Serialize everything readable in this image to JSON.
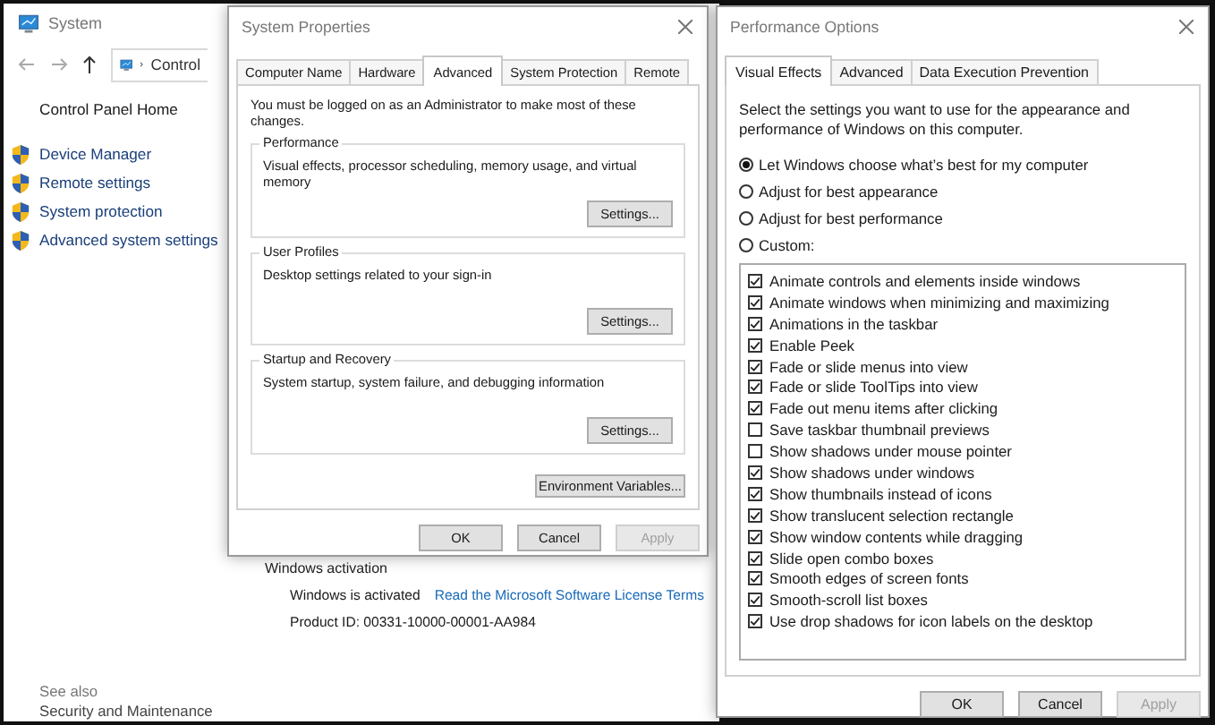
{
  "system_window": {
    "title": "System",
    "breadcrumb": "Control",
    "home_link": "Control Panel Home",
    "sidebar_items": [
      "Device Manager",
      "Remote settings",
      "System protection",
      "Advanced system settings"
    ],
    "see_also": "See also",
    "see_also_items": [
      "Security and Maintenance"
    ],
    "activation": {
      "heading": "Windows activation",
      "status": "Windows is activated",
      "link": "Read the Microsoft Software License Terms",
      "product_id": "Product ID: 00331-10000-00001-AA984"
    }
  },
  "system_properties": {
    "title": "System Properties",
    "tabs": [
      {
        "label": "Computer Name",
        "selected": false
      },
      {
        "label": "Hardware",
        "selected": false
      },
      {
        "label": "Advanced",
        "selected": true
      },
      {
        "label": "System Protection",
        "selected": false
      },
      {
        "label": "Remote",
        "selected": false
      }
    ],
    "admin_note": "You must be logged on as an Administrator to make most of these changes.",
    "groups": [
      {
        "title": "Performance",
        "description": "Visual effects, processor scheduling, memory usage, and virtual memory",
        "button": "Settings..."
      },
      {
        "title": "User Profiles",
        "description": "Desktop settings related to your sign-in",
        "button": "Settings..."
      },
      {
        "title": "Startup and Recovery",
        "description": "System startup, system failure, and debugging information",
        "button": "Settings..."
      }
    ],
    "env_button": "Environment Variables...",
    "buttons": [
      {
        "label": "OK",
        "disabled": false
      },
      {
        "label": "Cancel",
        "disabled": false
      },
      {
        "label": "Apply",
        "disabled": true
      }
    ]
  },
  "performance_options": {
    "title": "Performance Options",
    "tabs": [
      {
        "label": "Visual Effects",
        "selected": true
      },
      {
        "label": "Advanced",
        "selected": false
      },
      {
        "label": "Data Execution Prevention",
        "selected": false
      }
    ],
    "intro": "Select the settings you want to use for the appearance and performance of Windows on this computer.",
    "modes": [
      {
        "label": "Let Windows choose what’s best for my computer",
        "selected": true
      },
      {
        "label": "Adjust for best appearance",
        "selected": false
      },
      {
        "label": "Adjust for best performance",
        "selected": false
      },
      {
        "label": "Custom:",
        "selected": false
      }
    ],
    "effects": [
      {
        "label": "Animate controls and elements inside windows",
        "checked": true
      },
      {
        "label": "Animate windows when minimizing and maximizing",
        "checked": true
      },
      {
        "label": "Animations in the taskbar",
        "checked": true
      },
      {
        "label": "Enable Peek",
        "checked": true
      },
      {
        "label": "Fade or slide menus into view",
        "checked": true
      },
      {
        "label": "Fade or slide ToolTips into view",
        "checked": true
      },
      {
        "label": "Fade out menu items after clicking",
        "checked": true
      },
      {
        "label": "Save taskbar thumbnail previews",
        "checked": false
      },
      {
        "label": "Show shadows under mouse pointer",
        "checked": false
      },
      {
        "label": "Show shadows under windows",
        "checked": true
      },
      {
        "label": "Show thumbnails instead of icons",
        "checked": true
      },
      {
        "label": "Show translucent selection rectangle",
        "checked": true
      },
      {
        "label": "Show window contents while dragging",
        "checked": true
      },
      {
        "label": "Slide open combo boxes",
        "checked": true
      },
      {
        "label": "Smooth edges of screen fonts",
        "checked": true
      },
      {
        "label": "Smooth-scroll list boxes",
        "checked": true
      },
      {
        "label": "Use drop shadows for icon labels on the desktop",
        "checked": true
      }
    ],
    "buttons": [
      {
        "label": "OK",
        "disabled": false
      },
      {
        "label": "Cancel",
        "disabled": false
      },
      {
        "label": "Apply",
        "disabled": true
      }
    ]
  }
}
